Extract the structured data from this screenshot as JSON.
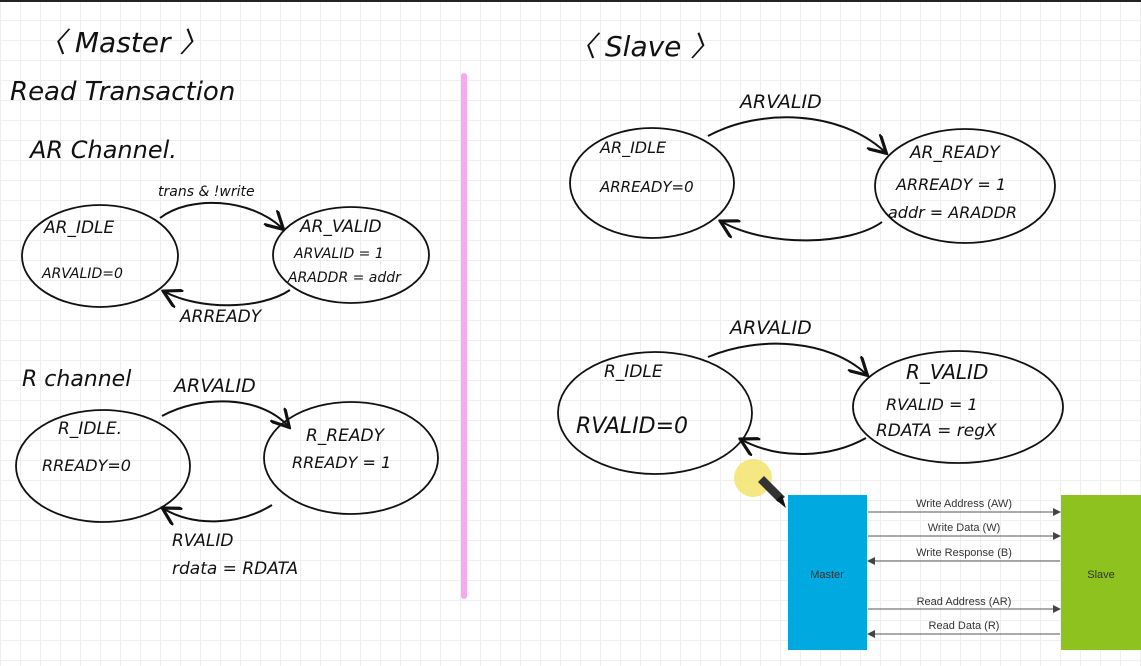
{
  "master": {
    "heading": "〈 Master 〉",
    "subheading": "Read Transaction",
    "ar_channel": {
      "title": "AR Channel.",
      "idle": {
        "name": "AR_IDLE",
        "line1": "ARVALID=0"
      },
      "valid": {
        "name": "AR_VALID",
        "line1": "ARVALID = 1",
        "line2": "ARADDR = addr"
      },
      "forward_label": "trans & !write",
      "back_label": "ARREADY"
    },
    "r_channel": {
      "title": "R channel",
      "idle": {
        "name": "R_IDLE.",
        "line1": "RREADY=0"
      },
      "ready": {
        "name": "R_READY",
        "line1": "RREADY = 1"
      },
      "forward_label": "ARVALID",
      "back_label": "RVALID",
      "back_label2": "rdata = RDATA"
    }
  },
  "slave": {
    "heading": "〈 Slave 〉",
    "ar": {
      "idle": {
        "name": "AR_IDLE",
        "line1": "ARREADY=0"
      },
      "ready": {
        "name": "AR_READY",
        "line1": "ARREADY = 1",
        "line2": "addr = ARADDR"
      },
      "forward_label": "ARVALID"
    },
    "r": {
      "idle": {
        "name": "R_IDLE",
        "line1": "RVALID=0"
      },
      "valid": {
        "name": "R_VALID",
        "line1": "RVALID = 1",
        "line2": "RDATA = regX"
      },
      "forward_label": "ARVALID"
    }
  },
  "axi_diagram": {
    "master_label": "Master",
    "slave_label": "Slave",
    "master_color": "#00a9e0",
    "slave_color": "#8dc21f",
    "channels": {
      "aw": "Write Address (AW)",
      "w": "Write Data (W)",
      "b": "Write Response (B)",
      "ar": "Read Address (AR)",
      "r": "Read Data (R)"
    }
  },
  "colors": {
    "divider": "#f7a8f0",
    "cursor_highlight": "#f3e36b"
  }
}
